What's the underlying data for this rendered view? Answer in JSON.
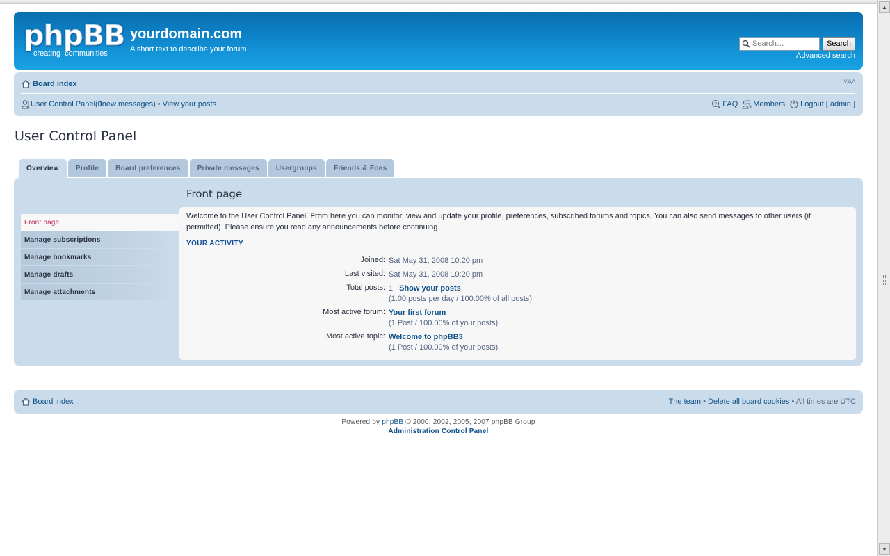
{
  "header": {
    "logo_main": "phpBB",
    "logo_sub_1": "creating",
    "logo_sub_2": "communities",
    "site_name": "yourdomain.com",
    "site_desc": "A short text to describe your forum",
    "search_placeholder": "Search…",
    "search_button": "Search",
    "advanced_search": "Advanced search"
  },
  "navbar": {
    "board_index": "Board index",
    "font_size": "A",
    "ucp_link": "User Control Panel",
    "ucp_paren_open": " (",
    "new_count": "0",
    "new_messages_suffix": " new messages)",
    "bullet": "•",
    "view_posts": "View your posts",
    "faq": "FAQ",
    "members": "Members",
    "logout": "Logout [ admin ]"
  },
  "page": {
    "title": "User Control Panel"
  },
  "tabs": [
    {
      "label": "Overview",
      "active": true
    },
    {
      "label": "Profile"
    },
    {
      "label": "Board preferences"
    },
    {
      "label": "Private messages"
    },
    {
      "label": "Usergroups"
    },
    {
      "label": "Friends & Foes"
    }
  ],
  "menu": [
    {
      "label": "Front page",
      "active": true
    },
    {
      "label": "Manage subscriptions"
    },
    {
      "label": "Manage bookmarks"
    },
    {
      "label": "Manage drafts"
    },
    {
      "label": "Manage attachments"
    }
  ],
  "content": {
    "title": "Front page",
    "intro": "Welcome to the User Control Panel. From here you can monitor, view and update your profile, preferences, subscribed forums and topics. You can also send messages to other users (if permitted). Please ensure you read any announcements before continuing.",
    "activity_heading": "YOUR ACTIVITY",
    "joined_label": "Joined:",
    "joined_value": "Sat May 31, 2008 10:20 pm",
    "last_visited_label": "Last visited:",
    "last_visited_value": "Sat May 31, 2008 10:20 pm",
    "total_posts_label": "Total posts:",
    "total_posts_count": "1",
    "total_posts_sep": " | ",
    "show_posts": "Show your posts",
    "posts_stats": "(1.00 posts per day / 100.00% of all posts)",
    "active_forum_label": "Most active forum:",
    "active_forum": "Your first forum",
    "active_forum_stats": "(1 Post / 100.00% of your posts)",
    "active_topic_label": "Most active topic:",
    "active_topic": "Welcome to phpBB3",
    "active_topic_stats": "(1 Post / 100.00% of your posts)"
  },
  "footer": {
    "board_index": "Board index",
    "the_team": "The team",
    "delete_cookies": "Delete all board cookies",
    "times": "All times are UTC",
    "bullet": "•",
    "powered_by": "Powered by",
    "phpbb": "phpBB",
    "copyright": "© 2000, 2002, 2005, 2007 phpBB Group",
    "acp": "Administration Control Panel"
  },
  "colors": {
    "header_blue": "#0d7fc4",
    "panel_bg": "#cadceb",
    "link": "#105289",
    "active_menu": "#bc2a4d"
  }
}
